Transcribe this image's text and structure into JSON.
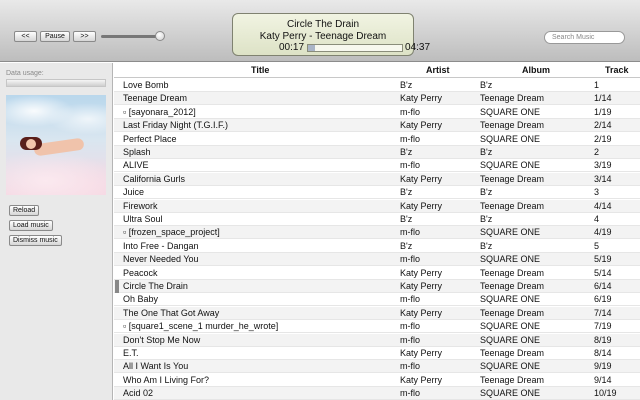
{
  "transport": {
    "prev_label": "<<",
    "pause_label": "Pause",
    "next_label": ">>"
  },
  "now_playing": {
    "title": "Circle The Drain",
    "subtitle": "Katy Perry - Teenage Dream",
    "elapsed": "00:17",
    "remaining": "04:37",
    "progress": 0.07
  },
  "search": {
    "placeholder": "Search Music"
  },
  "sidebar": {
    "usage_label": "Data usage:",
    "reload_label": "Reload",
    "load_label": "Load music",
    "dismiss_label": "Dismiss music"
  },
  "table": {
    "headers": {
      "title": "Title",
      "artist": "Artist",
      "album": "Album",
      "track": "Track"
    },
    "playing_index": 15,
    "rows": [
      {
        "title": "Love Bomb",
        "artist": "B'z",
        "album": "B'z",
        "track": "1"
      },
      {
        "title": "Teenage Dream",
        "artist": "Katy Perry",
        "album": "Teenage Dream",
        "track": "1/14"
      },
      {
        "title": "▫ [sayonara_2012]",
        "artist": "m-flo",
        "album": "SQUARE ONE",
        "track": "1/19"
      },
      {
        "title": "Last Friday Night (T.G.I.F.)",
        "artist": "Katy Perry",
        "album": "Teenage Dream",
        "track": "2/14"
      },
      {
        "title": "Perfect Place",
        "artist": "m-flo",
        "album": "SQUARE ONE",
        "track": "2/19"
      },
      {
        "title": "Splash",
        "artist": "B'z",
        "album": "B'z",
        "track": "2"
      },
      {
        "title": "ALIVE",
        "artist": "m-flo",
        "album": "SQUARE ONE",
        "track": "3/19"
      },
      {
        "title": "California Gurls",
        "artist": "Katy Perry",
        "album": "Teenage Dream",
        "track": "3/14"
      },
      {
        "title": "Juice",
        "artist": "B'z",
        "album": "B'z",
        "track": "3"
      },
      {
        "title": "Firework",
        "artist": "Katy Perry",
        "album": "Teenage Dream",
        "track": "4/14"
      },
      {
        "title": "Ultra Soul",
        "artist": "B'z",
        "album": "B'z",
        "track": "4"
      },
      {
        "title": "▫ [frozen_space_project]",
        "artist": "m-flo",
        "album": "SQUARE ONE",
        "track": "4/19"
      },
      {
        "title": "Into Free - Dangan",
        "artist": "B'z",
        "album": "B'z",
        "track": "5"
      },
      {
        "title": "Never Needed You",
        "artist": "m-flo",
        "album": "SQUARE ONE",
        "track": "5/19"
      },
      {
        "title": "Peacock",
        "artist": "Katy Perry",
        "album": "Teenage Dream",
        "track": "5/14"
      },
      {
        "title": "Circle The Drain",
        "artist": "Katy Perry",
        "album": "Teenage Dream",
        "track": "6/14"
      },
      {
        "title": "Oh Baby",
        "artist": "m-flo",
        "album": "SQUARE ONE",
        "track": "6/19"
      },
      {
        "title": "The One That Got Away",
        "artist": "Katy Perry",
        "album": "Teenage Dream",
        "track": "7/14"
      },
      {
        "title": "▫ [square1_scene_1 murder_he_wrote]",
        "artist": "m-flo",
        "album": "SQUARE ONE",
        "track": "7/19"
      },
      {
        "title": "Don't Stop Me Now",
        "artist": "m-flo",
        "album": "SQUARE ONE",
        "track": "8/19"
      },
      {
        "title": "E.T.",
        "artist": "Katy Perry",
        "album": "Teenage Dream",
        "track": "8/14"
      },
      {
        "title": "All I Want Is You",
        "artist": "m-flo",
        "album": "SQUARE ONE",
        "track": "9/19"
      },
      {
        "title": "Who Am I Living For?",
        "artist": "Katy Perry",
        "album": "Teenage Dream",
        "track": "9/14"
      },
      {
        "title": "Acid 02",
        "artist": "m-flo",
        "album": "SQUARE ONE",
        "track": "10/19"
      }
    ]
  }
}
